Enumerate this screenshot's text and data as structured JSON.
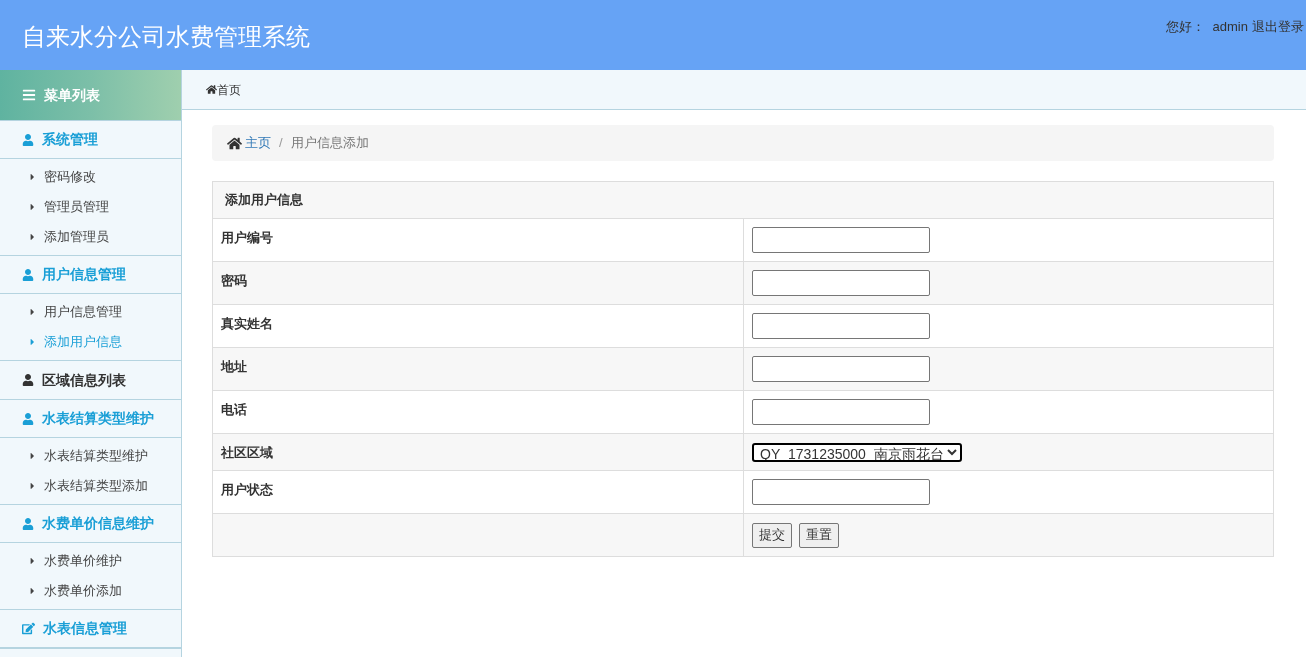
{
  "header": {
    "title": "自来水分公司水费管理系统",
    "greeting": "您好：",
    "user": "admin",
    "logout": "退出登录"
  },
  "sidebar": {
    "title": "菜单列表",
    "groups": [
      {
        "label": "系统管理",
        "kind": "user",
        "expanded": true,
        "items": [
          {
            "label": "密码修改",
            "selected": false
          },
          {
            "label": "管理员管理",
            "selected": false
          },
          {
            "label": "添加管理员",
            "selected": false
          }
        ]
      },
      {
        "label": "用户信息管理",
        "kind": "user",
        "expanded": true,
        "items": [
          {
            "label": "用户信息管理",
            "selected": false
          },
          {
            "label": "添加用户信息",
            "selected": true
          }
        ]
      },
      {
        "label": "区域信息列表",
        "kind": "user",
        "expanded": false
      },
      {
        "label": "水表结算类型维护",
        "kind": "user",
        "expanded": true,
        "items": [
          {
            "label": "水表结算类型维护",
            "selected": false
          },
          {
            "label": "水表结算类型添加",
            "selected": false
          }
        ]
      },
      {
        "label": "水费单价信息维护",
        "kind": "user",
        "expanded": true,
        "items": [
          {
            "label": "水费单价维护",
            "selected": false
          },
          {
            "label": "水费单价添加",
            "selected": false
          }
        ]
      },
      {
        "label": "水表信息管理",
        "kind": "edit",
        "expanded": true
      }
    ]
  },
  "topbar": {
    "home": "首页"
  },
  "breadcrumb": {
    "home": "主页",
    "separator": "/",
    "current": "用户信息添加"
  },
  "form": {
    "title": "添加用户信息",
    "fields": [
      {
        "label": "用户编号",
        "kind": "text"
      },
      {
        "label": "密码",
        "kind": "text"
      },
      {
        "label": "真实姓名",
        "kind": "text"
      },
      {
        "label": "地址",
        "kind": "text"
      },
      {
        "label": "电话",
        "kind": "text"
      },
      {
        "label": "社区区域",
        "kind": "select",
        "value": "QY_1731235000_南京雨花台"
      },
      {
        "label": "用户状态",
        "kind": "text"
      }
    ],
    "buttons": [
      "提交",
      "重置"
    ]
  }
}
